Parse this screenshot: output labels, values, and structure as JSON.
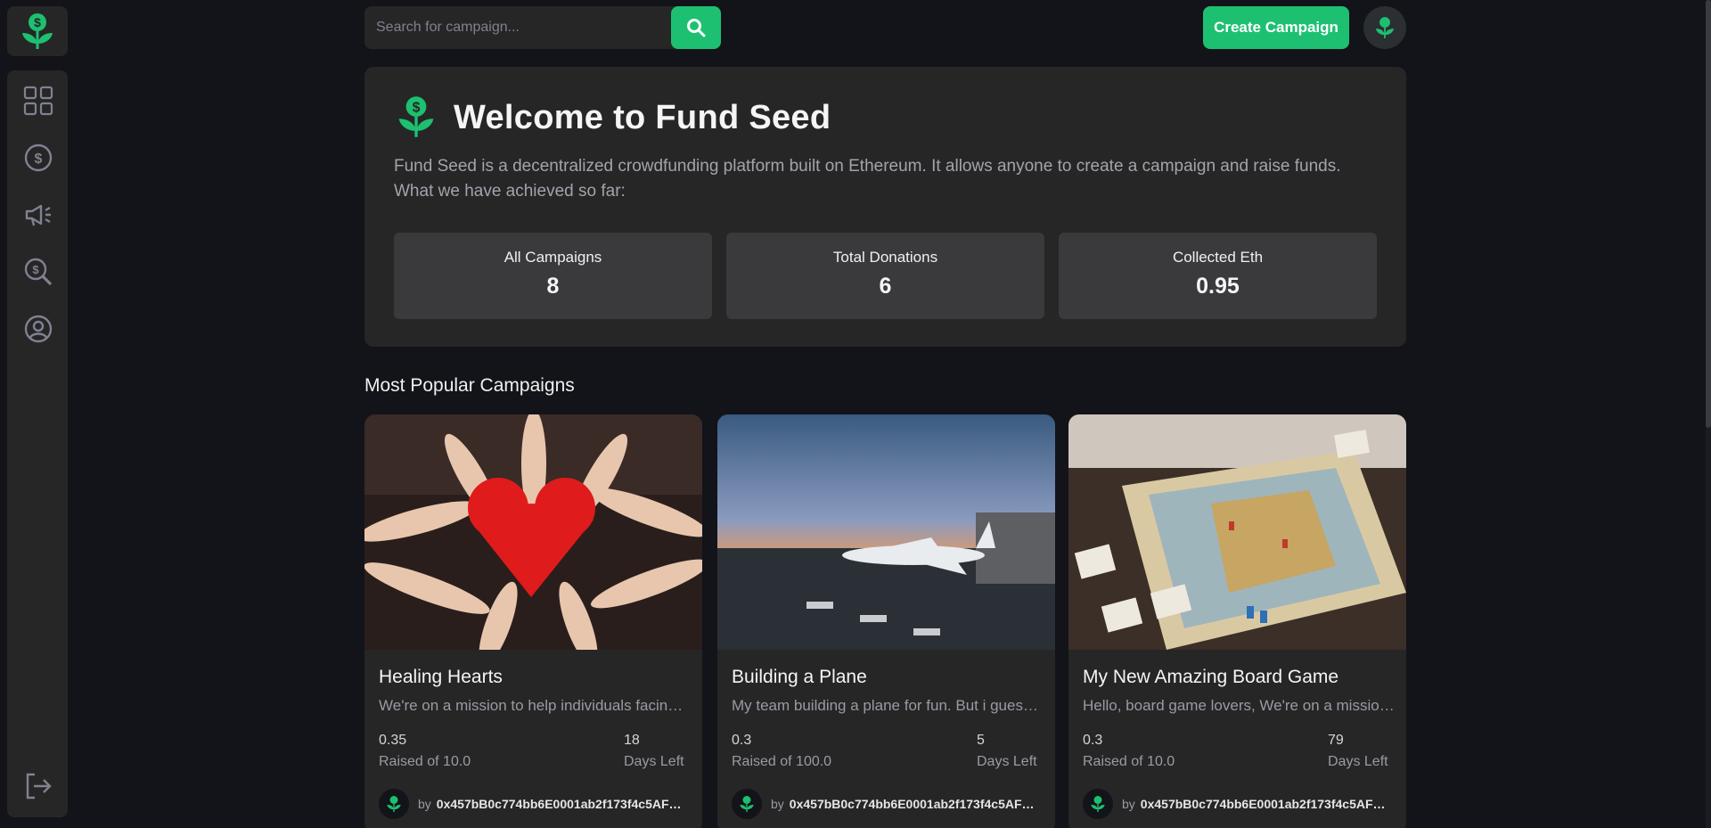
{
  "brand": {
    "accent": "#1dc071",
    "logo_icon": "seedling-dollar-icon"
  },
  "sidebar": {
    "items": [
      {
        "icon": "dashboard-grid-icon"
      },
      {
        "icon": "dollar-circle-icon"
      },
      {
        "icon": "megaphone-icon"
      },
      {
        "icon": "search-dollar-icon"
      },
      {
        "icon": "profile-icon"
      }
    ],
    "logout_icon": "logout-icon"
  },
  "header": {
    "search_placeholder": "Search for campaign...",
    "create_label": "Create Campaign"
  },
  "welcome": {
    "title": "Welcome to Fund Seed",
    "description": "Fund Seed is a decentralized crowdfunding platform built on Ethereum. It allows anyone to create a campaign and raise funds. What we have achieved so far:",
    "stats": [
      {
        "label": "All Campaigns",
        "value": "8"
      },
      {
        "label": "Total Donations",
        "value": "6"
      },
      {
        "label": "Collected Eth",
        "value": "0.95"
      }
    ]
  },
  "popular": {
    "title": "Most Popular Campaigns",
    "cards": [
      {
        "title": "Healing Hearts",
        "description": "We're on a mission to help individuals facing health challenges",
        "raised": "0.35",
        "raised_label": "Raised of 10.0",
        "days": "18",
        "days_label": "Days Left",
        "by": "by",
        "owner": "0x457bB0c774bb6E0001ab2f173f4c5AF5..."
      },
      {
        "title": "Building a Plane",
        "description": "My team building a plane for fun. But i guess we need help",
        "raised": "0.3",
        "raised_label": "Raised of 100.0",
        "days": "5",
        "days_label": "Days Left",
        "by": "by",
        "owner": "0x457bB0c774bb6E0001ab2f173f4c5AF5..."
      },
      {
        "title": "My New Amazing Board Game",
        "description": "Hello, board game lovers, We're on a mission to bring a new game",
        "raised": "0.3",
        "raised_label": "Raised of 10.0",
        "days": "79",
        "days_label": "Days Left",
        "by": "by",
        "owner": "0x457bB0c774bb6E0001ab2f173f4c5AF5..."
      }
    ]
  }
}
